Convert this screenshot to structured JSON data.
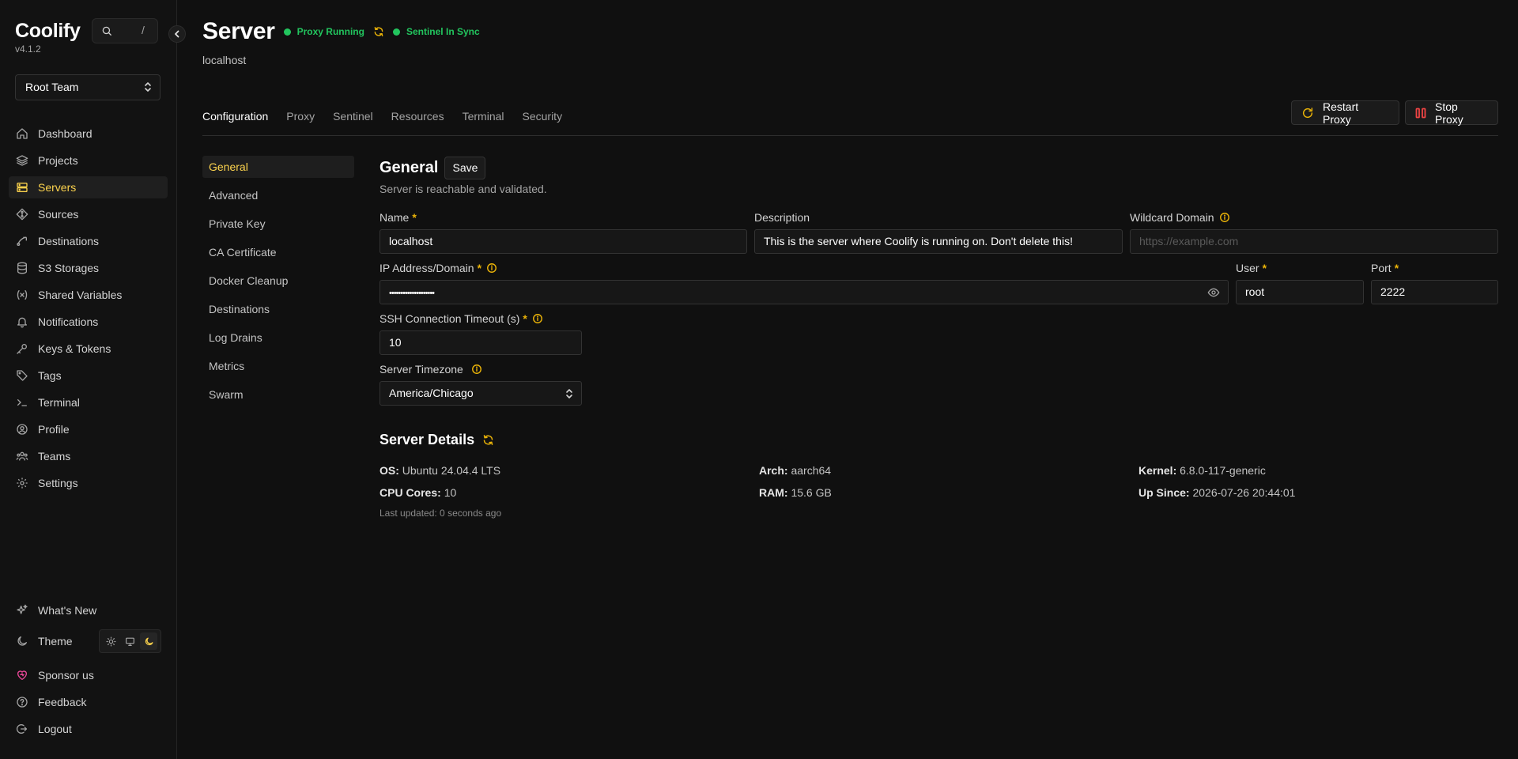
{
  "app": {
    "name": "Coolify",
    "version": "v4.1.2"
  },
  "search": {
    "shortcut": "/"
  },
  "team": {
    "selected": "Root Team"
  },
  "nav": [
    {
      "label": "Dashboard",
      "icon": "home-icon",
      "active": false
    },
    {
      "label": "Projects",
      "icon": "layers-icon",
      "active": false
    },
    {
      "label": "Servers",
      "icon": "server-icon",
      "active": true
    },
    {
      "label": "Sources",
      "icon": "git-icon",
      "active": false
    },
    {
      "label": "Destinations",
      "icon": "destination-icon",
      "active": false
    },
    {
      "label": "S3 Storages",
      "icon": "database-icon",
      "active": false
    },
    {
      "label": "Shared Variables",
      "icon": "variable-icon",
      "active": false
    },
    {
      "label": "Notifications",
      "icon": "bell-icon",
      "active": false
    },
    {
      "label": "Keys & Tokens",
      "icon": "key-icon",
      "active": false
    },
    {
      "label": "Tags",
      "icon": "tag-icon",
      "active": false
    },
    {
      "label": "Terminal",
      "icon": "terminal-icon",
      "active": false
    },
    {
      "label": "Profile",
      "icon": "user-icon",
      "active": false
    },
    {
      "label": "Teams",
      "icon": "users-icon",
      "active": false
    },
    {
      "label": "Settings",
      "icon": "gear-icon",
      "active": false
    }
  ],
  "bottom_nav": {
    "whats_new": "What's New",
    "theme": "Theme",
    "sponsor": "Sponsor us",
    "feedback": "Feedback",
    "logout": "Logout"
  },
  "page": {
    "title": "Server",
    "subtitle": "localhost",
    "statuses": [
      "Proxy Running",
      "Sentinel In Sync"
    ],
    "status_color": "#22c55e",
    "accent": "#fcd34d"
  },
  "tabs": [
    "Configuration",
    "Proxy",
    "Sentinel",
    "Resources",
    "Terminal",
    "Security"
  ],
  "actions": {
    "restart": "Restart Proxy",
    "stop": "Stop Proxy"
  },
  "sub_nav": [
    "General",
    "Advanced",
    "Private Key",
    "CA Certificate",
    "Docker Cleanup",
    "Destinations",
    "Log Drains",
    "Metrics",
    "Swarm"
  ],
  "general": {
    "title": "General",
    "save": "Save",
    "description": "Server is reachable and validated.",
    "fields": {
      "name": {
        "label": "Name",
        "value": "localhost"
      },
      "description": {
        "label": "Description",
        "value": "This is the server where Coolify is running on. Don't delete this!"
      },
      "wildcard": {
        "label": "Wildcard Domain",
        "placeholder": "https://example.com"
      },
      "ip": {
        "label": "IP Address/Domain",
        "value": "••••••••••••••••••••"
      },
      "user": {
        "label": "User",
        "value": "root"
      },
      "port": {
        "label": "Port",
        "value": "2222"
      },
      "timeout": {
        "label": "SSH Connection Timeout (s)",
        "value": "10"
      },
      "timezone": {
        "label": "Server Timezone",
        "value": "America/Chicago"
      }
    }
  },
  "details": {
    "title": "Server Details",
    "os": {
      "label": "OS:",
      "value": "Ubuntu 24.04.4 LTS"
    },
    "arch": {
      "label": "Arch:",
      "value": "aarch64"
    },
    "kernel": {
      "label": "Kernel:",
      "value": "6.8.0-117-generic"
    },
    "cpu": {
      "label": "CPU Cores:",
      "value": "10"
    },
    "ram": {
      "label": "RAM:",
      "value": "15.6 GB"
    },
    "up": {
      "label": "Up Since:",
      "value": "2026-07-26 20:44:01"
    },
    "updated": "Last updated: 0 seconds ago"
  }
}
